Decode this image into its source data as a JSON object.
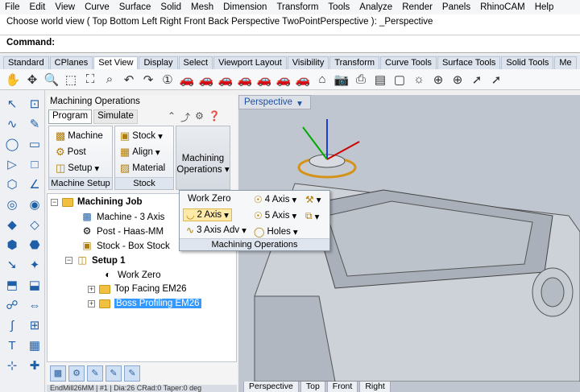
{
  "menu": [
    "File",
    "Edit",
    "View",
    "Curve",
    "Surface",
    "Solid",
    "Mesh",
    "Dimension",
    "Transform",
    "Tools",
    "Analyze",
    "Render",
    "Panels",
    "RhinoCAM",
    "Help"
  ],
  "command_history": "Choose world view ( Top  Bottom  Left  Right  Front  Back  Perspective  TwoPointPerspective ): _Perspective",
  "command_label": "Command:",
  "toolbar_tabs": [
    "Standard",
    "CPlanes",
    "Set View",
    "Display",
    "Select",
    "Viewport Layout",
    "Visibility",
    "Transform",
    "Curve Tools",
    "Surface Tools",
    "Solid Tools",
    "Me"
  ],
  "active_toolbar_tab": "Set View",
  "toolbar_icons": [
    "pan-icon",
    "rotate-icon",
    "zoom-icon",
    "zoom-window-icon",
    "zoom-extents-icon",
    "zoom-selected-icon",
    "undo-view-icon",
    "redo-view-icon",
    "zoom-1-1-icon",
    "car-icon",
    "car-icon",
    "car-icon",
    "car-icon",
    "car-icon",
    "car-icon",
    "car-icon",
    "house-icon",
    "camera-icon",
    "printer-icon",
    "layout-icon",
    "paper-icon",
    "sun-icon",
    "target-icon",
    "target-icon",
    "arrow-icon",
    "arrow-icon"
  ],
  "panel": {
    "title": "Machining Operations",
    "tabs": [
      "Program",
      "Simulate"
    ],
    "groups": {
      "machine_setup": {
        "caption": "Machine Setup",
        "buttons": [
          "Machine",
          "Post",
          "Setup"
        ]
      },
      "stock": {
        "caption": "Stock",
        "buttons": [
          "Stock",
          "Align",
          "Material"
        ]
      },
      "operations": {
        "label": "Machining Operations"
      }
    },
    "tree": {
      "root": "Machining Job",
      "machine": "Machine - 3 Axis",
      "post": "Post - Haas-MM",
      "stock": "Stock - Box Stock",
      "setup": "Setup 1",
      "work_zero": "Work Zero",
      "op1": "Top Facing EM26",
      "op2": "Boss Profiling EM26"
    },
    "status": "EndMill26MM | #1 | Dia:26  CRad:0  Taper:0 deg"
  },
  "popup": {
    "work_zero": "Work Zero",
    "axis2": "2 Axis",
    "axis3": "3 Axis Adv",
    "axis4": "4 Axis",
    "axis5": "5 Axis",
    "holes": "Holes",
    "caption": "Machining Operations"
  },
  "viewport": {
    "title": "Perspective",
    "tabs": [
      "Perspective",
      "Top",
      "Front",
      "Right"
    ]
  }
}
